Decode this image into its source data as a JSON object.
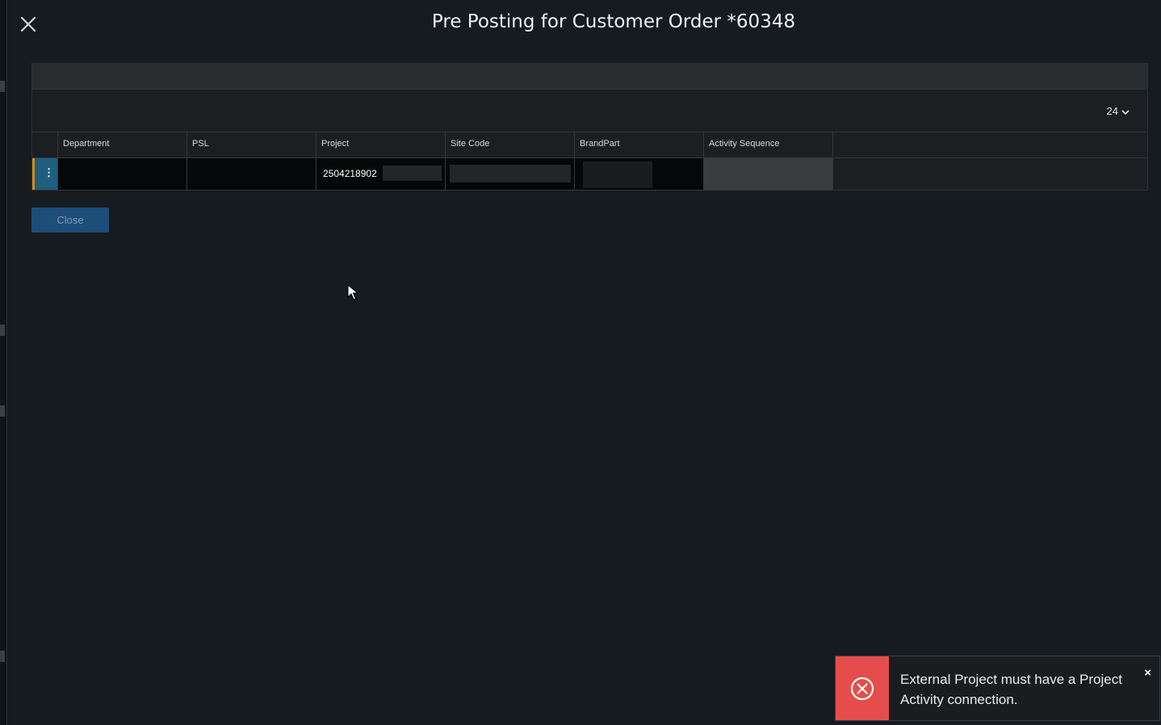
{
  "dialog": {
    "title": "Pre Posting for Customer Order *60348",
    "close_icon": "close-x-icon"
  },
  "grid": {
    "page_size": "24",
    "columns": [
      "Department",
      "PSL",
      "Project",
      "Site Code",
      "BrandPart",
      "Activity Sequence"
    ],
    "rows": [
      {
        "department": "",
        "psl": "",
        "project": "2504218902",
        "site_code": "",
        "brand_part": "",
        "activity_sequence": ""
      }
    ],
    "row_menu_icon": "more-vertical-icon"
  },
  "buttons": {
    "close_label": "Close"
  },
  "toast": {
    "message": "External Project must have a Project Activity connection.",
    "icon": "error-circle-x-icon",
    "close_glyph": "×",
    "color": "#e54d4d"
  },
  "colors": {
    "accent_blue": "#1d4d79",
    "row_marker_orange": "#d98a17"
  }
}
